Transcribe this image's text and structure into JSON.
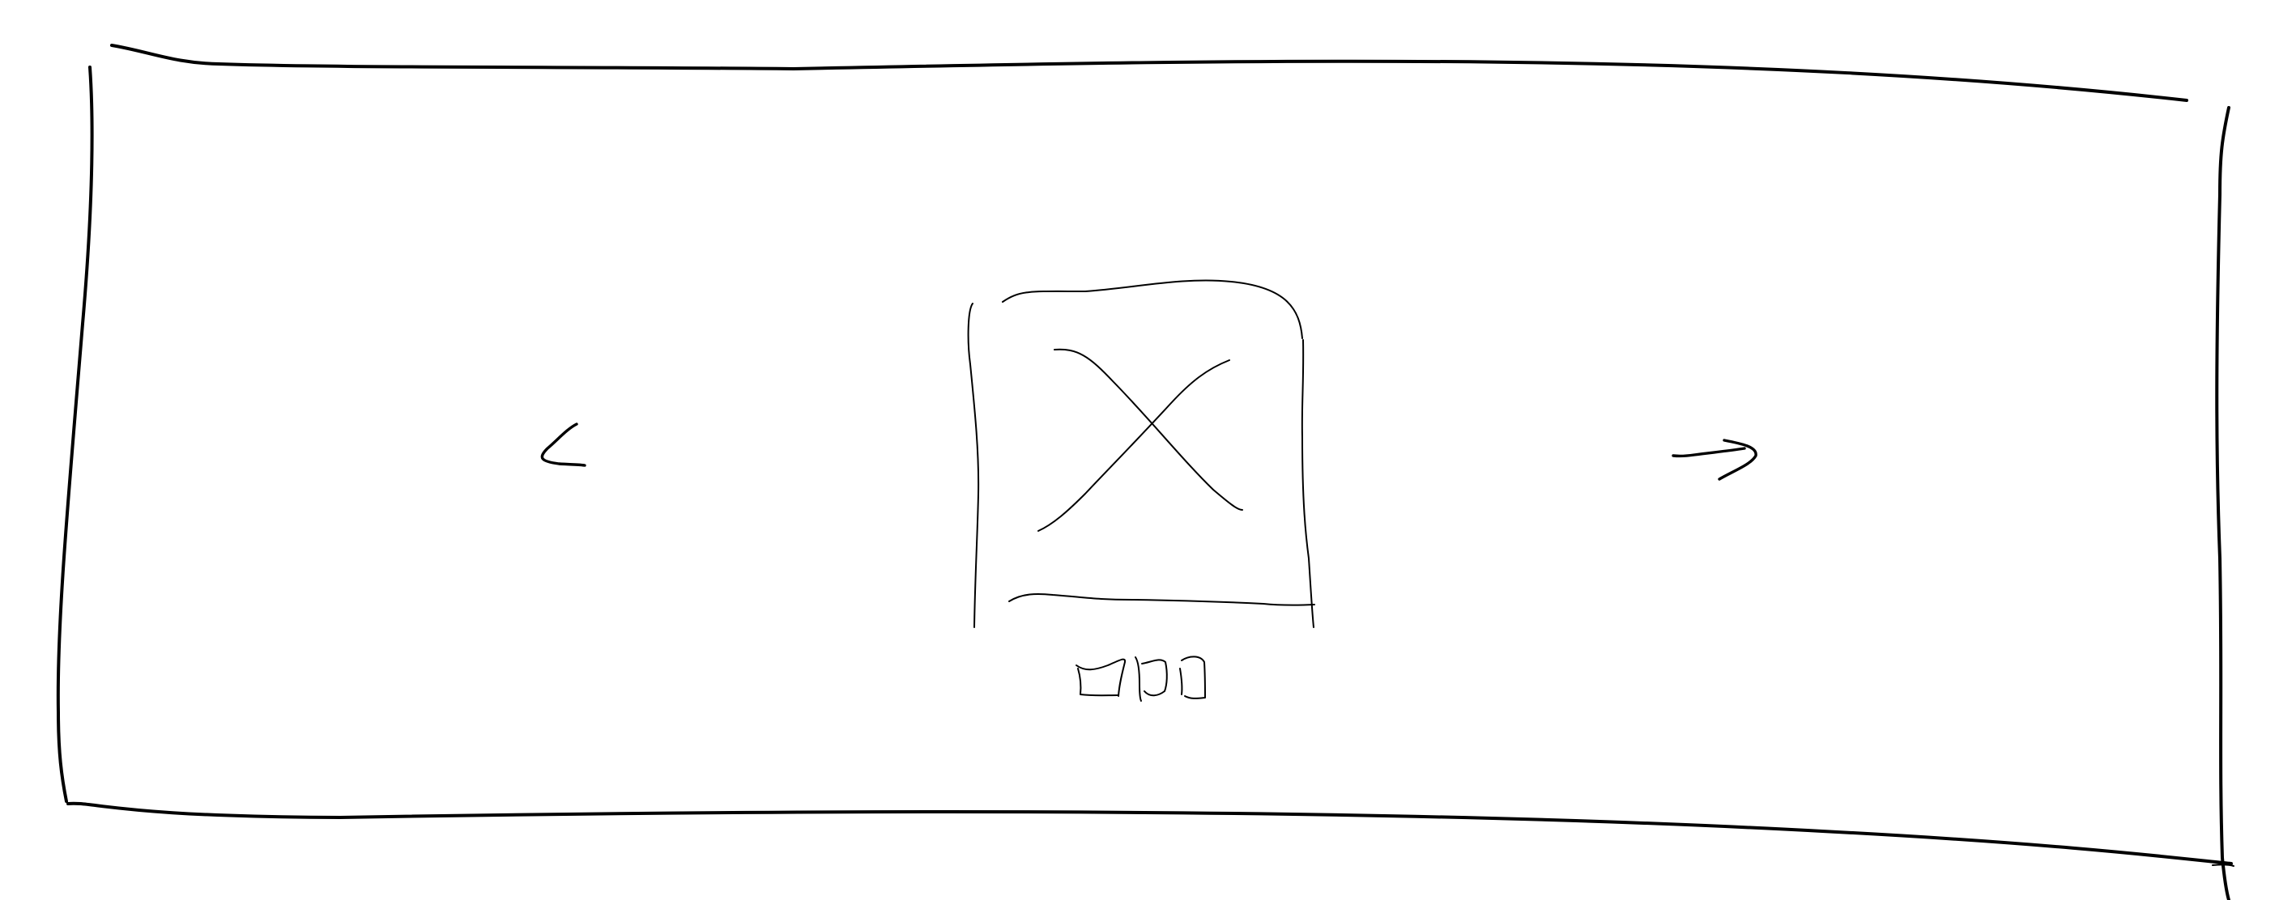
{
  "carousel": {
    "ink_color": "#000000",
    "background_color": "#ffffff",
    "previous_control": {
      "icon": "chevron-left-icon"
    },
    "next_control": {
      "icon": "arrow-right-icon"
    },
    "slide": {
      "icon": "image-placeholder-icon"
    },
    "pagination": {
      "dot_count": 3,
      "active_index": 0
    }
  }
}
